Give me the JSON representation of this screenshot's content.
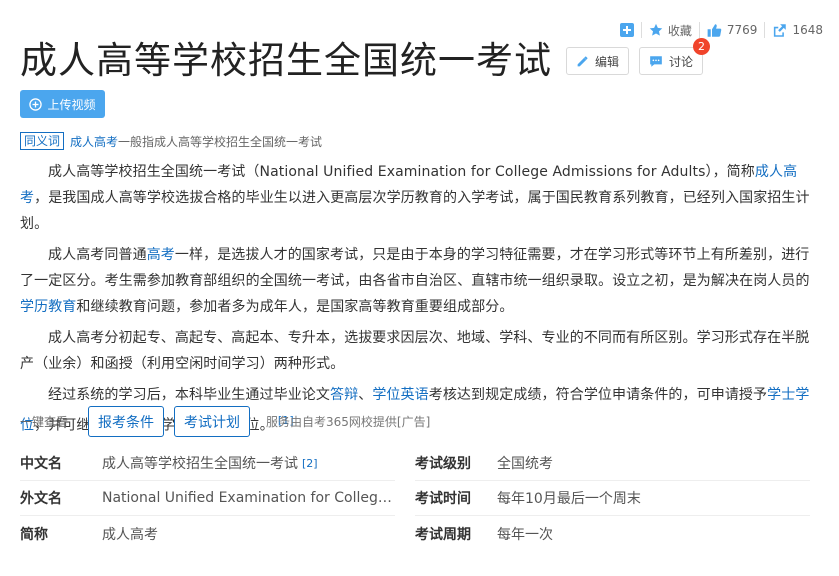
{
  "topbar": {
    "favorite_label": "收藏",
    "like_count": "7769",
    "share_count": "1648"
  },
  "header": {
    "title": "成人高等学校招生全国统一考试",
    "edit_label": "编辑",
    "discuss_label": "讨论",
    "discuss_badge": "2"
  },
  "upload": {
    "label": "上传视频"
  },
  "synonym": {
    "tag": "同义词",
    "term": "成人高考",
    "desc": "一般指成人高等学校招生全国统一考试"
  },
  "paragraphs": {
    "p1": {
      "a": "成人高等学校招生全国统一考试（National Unified Examination for College Admissions for Adults），简称",
      "link1": "成人高考",
      "b": "，是我国成人高等学校选拔合格的毕业生以进入更高层次学历教育的入学考试，属于国民教育系列教育，已经列入国家招生计划。"
    },
    "p2": {
      "a": "成人高考同普通",
      "link1": "高考",
      "b": "一样，是选拔人才的国家考试，只是由于本身的学习特征需要，才在学习形式等环节上有所差别，进行了一定区分。考生需参加教育部组织的全国统一考试，由各省市自治区、直辖市统一组织录取。设立之初，是为解决在岗人员的",
      "link2": "学历教育",
      "c": "和继续教育问题，参加者多为成年人，是国家高等教育重要组成部分。"
    },
    "p3": {
      "a": "成人高考分初起专、高起专、高起本、专升本，选拔要求因层次、地域、学科、专业的不同而有所区别。学习形式存在半脱产（业余）和函授（利用空闲时间学习）两种形式。"
    },
    "p4": {
      "a": "经过系统的学习后，本科毕业生通过毕业论文",
      "link1": "答辩",
      "b": "、",
      "link2": "学位英语",
      "c": "考核达到规定成绩，符合学位申请条件的，可申请授予",
      "link3": "学士学位",
      "d": "，并可继续攻读",
      "link4": "硕士",
      "e": "学位和",
      "link5": "博士",
      "f": "学位。",
      "ref": "[1]"
    }
  },
  "actions": {
    "lead": "一键查看",
    "btn1": "报考条件",
    "btn2": "考试计划",
    "note": "服务由自考365网校提供[广告]"
  },
  "info": {
    "left": [
      {
        "key": "中文名",
        "value": "成人高等学校招生全国统一考试",
        "ref": "[2]"
      },
      {
        "key": "外文名",
        "value": "National Unified Examination for College Ad...",
        "ref": ""
      },
      {
        "key": "简称",
        "value": "成人高考",
        "ref": ""
      }
    ],
    "right": [
      {
        "key": "考试级别",
        "value": "全国统考"
      },
      {
        "key": "考试时间",
        "value": "每年10月最后一个周末"
      },
      {
        "key": "考试周期",
        "value": "每年一次"
      }
    ]
  },
  "colors": {
    "link": "#136ec2",
    "upload_bg": "#4ba6ee",
    "badge": "#f0442b"
  }
}
